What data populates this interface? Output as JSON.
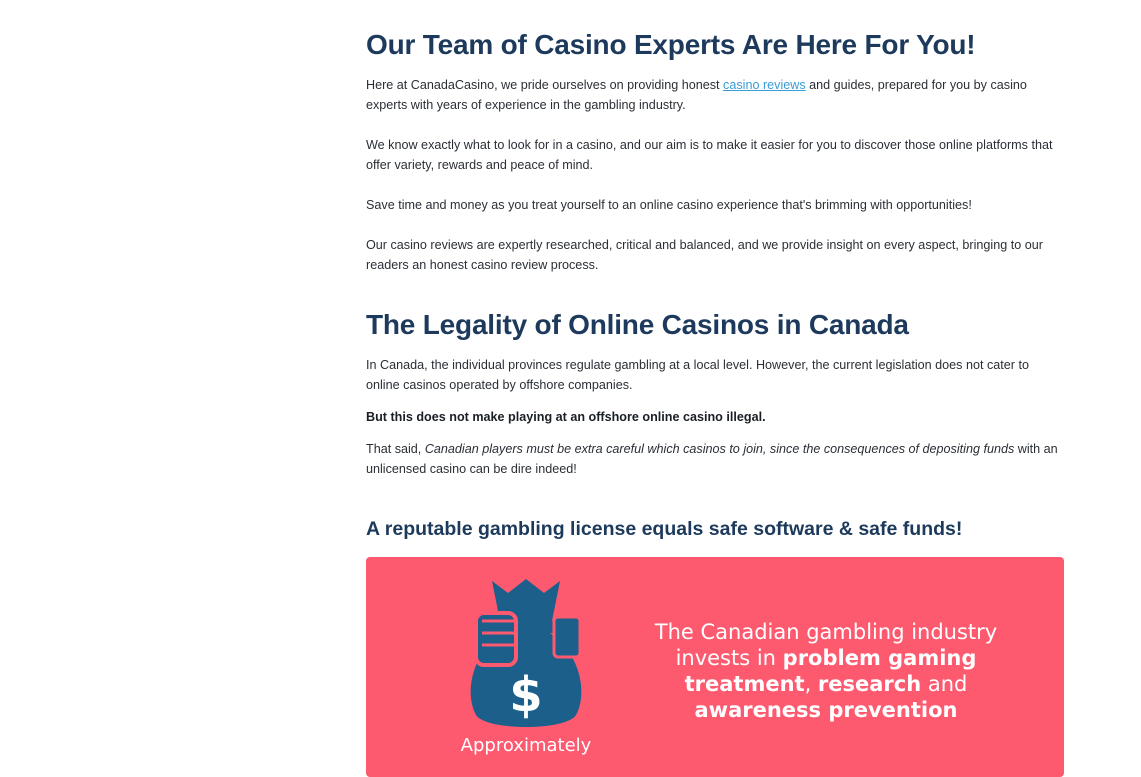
{
  "section1": {
    "heading": "Our Team of Casino Experts Are Here For You!",
    "p1_before_link": "Here at CanadaCasino, we pride ourselves on providing honest ",
    "p1_link": "casino reviews",
    "p1_after_link": " and guides, prepared for you by casino experts with years of experience in the gambling industry.",
    "p2": "We know exactly what to look for in a casino, and our aim is to make it easier for you to discover those online platforms that offer variety, rewards and peace of mind.",
    "p3": "Save time and money as you treat yourself to an online casino experience that's brimming with opportunities!",
    "p4": "Our casino reviews are expertly researched, critical and balanced, and we provide insight on every aspect, bringing to our readers an honest casino review process."
  },
  "section2": {
    "heading": "The Legality of Online Casinos in Canada",
    "p1": "In Canada, the individual provinces regulate gambling at a local level. However, the current legislation does not cater to online casinos operated by offshore companies.",
    "bold": "But this does not make playing at an offshore online casino illegal.",
    "p3_before_em": "That said, ",
    "p3_em": "Canadian players must be extra careful which casinos to join, since the consequences of depositing funds",
    "p3_after_em": " with an unlicensed casino can be dire indeed!"
  },
  "section3": {
    "heading": "A reputable gambling license equals safe software & safe funds!"
  },
  "banner": {
    "line1": "The Canadian gambling industry",
    "invests": "invests in ",
    "problem_gaming": "problem gaming",
    "treatment": "treatment",
    "comma": ", ",
    "research": "research",
    "and": " and",
    "awareness": "awareness prevention",
    "approx": "Approximately",
    "icon": "moneybag-dollar-icon",
    "colors": {
      "bg": "#fd5a70",
      "icon": "#1c5f8a"
    }
  }
}
